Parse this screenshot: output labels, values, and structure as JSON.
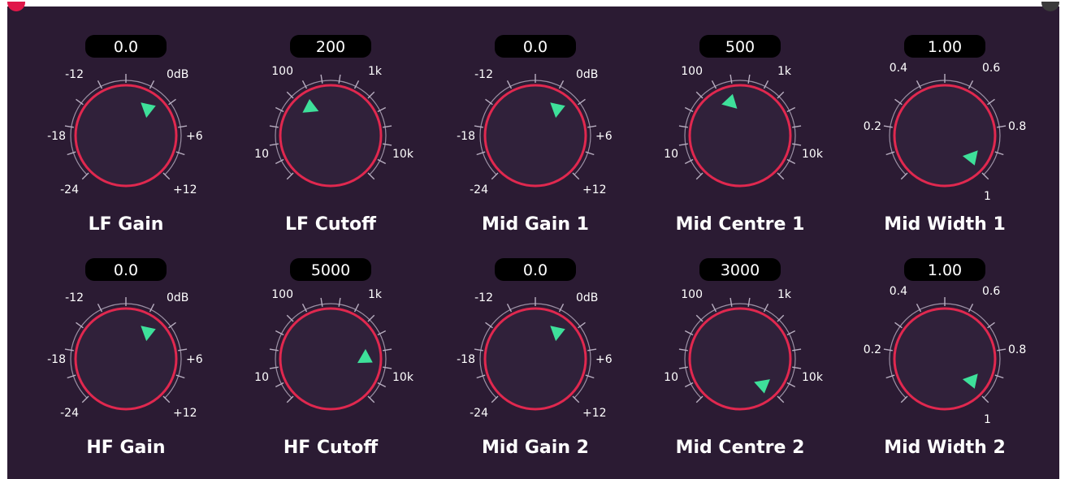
{
  "colors": {
    "background": "#2b1b33",
    "knob_face": "#30213a",
    "knob_ring": "#e0284f",
    "indicator": "#3ee09a",
    "tick": "#b8aec0",
    "readout_bg": "#000000",
    "text": "#ffffff"
  },
  "knobs": [
    {
      "name": "LF Gain",
      "value": "0.0",
      "labels": [
        "-12",
        "0dB",
        "-18",
        "+6",
        "-24",
        "+12"
      ]
    },
    {
      "name": "LF Cutoff",
      "value": "200",
      "labels": [
        "100",
        "1k",
        "10",
        "10k"
      ]
    },
    {
      "name": "Mid Gain 1",
      "value": "0.0",
      "labels": [
        "-12",
        "0dB",
        "-18",
        "+6",
        "-24",
        "+12"
      ]
    },
    {
      "name": "Mid Centre 1",
      "value": "500",
      "labels": [
        "100",
        "1k",
        "10",
        "10k"
      ]
    },
    {
      "name": "Mid Width 1",
      "value": "1.00",
      "labels": [
        "0.4",
        "0.6",
        "0.2",
        "0.8",
        "1"
      ]
    },
    {
      "name": "HF Gain",
      "value": "0.0",
      "labels": [
        "-12",
        "0dB",
        "-18",
        "+6",
        "-24",
        "+12"
      ]
    },
    {
      "name": "HF Cutoff",
      "value": "5000",
      "labels": [
        "100",
        "1k",
        "10",
        "10k"
      ]
    },
    {
      "name": "Mid Gain 2",
      "value": "0.0",
      "labels": [
        "-12",
        "0dB",
        "-18",
        "+6",
        "-24",
        "+12"
      ]
    },
    {
      "name": "Mid Centre 2",
      "value": "3000",
      "labels": [
        "100",
        "1k",
        "10",
        "10k"
      ]
    },
    {
      "name": "Mid Width 2",
      "value": "1.00",
      "labels": [
        "0.4",
        "0.6",
        "0.2",
        "0.8",
        "1"
      ]
    }
  ]
}
